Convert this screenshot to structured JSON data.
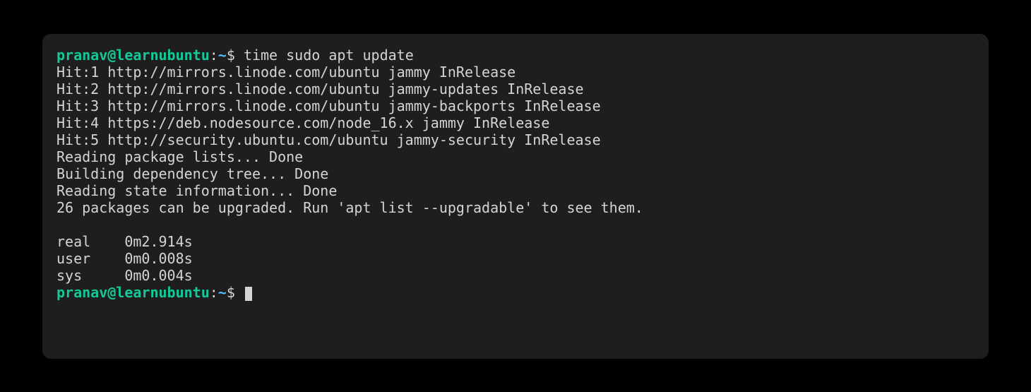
{
  "prompt": {
    "user_host": "pranav@learnubuntu",
    "colon": ":",
    "path": "~",
    "dollar": "$ "
  },
  "command1": "time sudo apt update",
  "output": {
    "line1": "Hit:1 http://mirrors.linode.com/ubuntu jammy InRelease",
    "line2": "Hit:2 http://mirrors.linode.com/ubuntu jammy-updates InRelease",
    "line3": "Hit:3 http://mirrors.linode.com/ubuntu jammy-backports InRelease",
    "line4": "Hit:4 https://deb.nodesource.com/node_16.x jammy InRelease",
    "line5": "Hit:5 http://security.ubuntu.com/ubuntu jammy-security InRelease",
    "line6": "Reading package lists... Done",
    "line7": "Building dependency tree... Done",
    "line8": "Reading state information... Done",
    "line9": "26 packages can be upgraded. Run 'apt list --upgradable' to see them.",
    "blank": "",
    "time_real": "real    0m2.914s",
    "time_user": "user    0m0.008s",
    "time_sys": "sys     0m0.004s"
  }
}
